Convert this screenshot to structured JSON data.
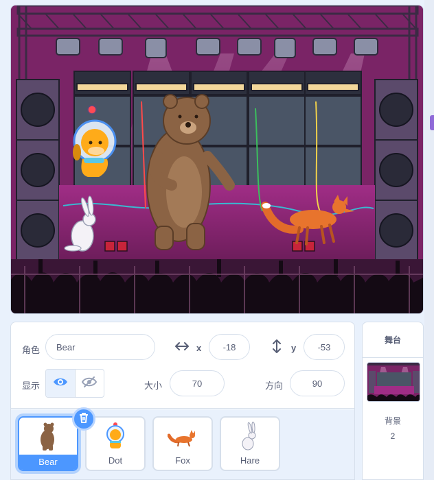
{
  "sprite_info": {
    "sprite_label": "角色",
    "sprite_name": "Bear",
    "x_label": "x",
    "x_value": "-18",
    "y_label": "y",
    "y_value": "-53",
    "show_label": "显示",
    "size_label": "大小",
    "size_value": "70",
    "direction_label": "方向",
    "direction_value": "90"
  },
  "sprites": [
    {
      "name": "Bear",
      "selected": true
    },
    {
      "name": "Dot",
      "selected": false
    },
    {
      "name": "Fox",
      "selected": false
    },
    {
      "name": "Hare",
      "selected": false
    }
  ],
  "stage_panel": {
    "title": "舞台",
    "backdrops_label": "背景",
    "backdrops_count": "2"
  },
  "colors": {
    "accent": "#4c97ff",
    "stage_purple": "#8a2a73",
    "panel_bg": "#e9f1fc"
  }
}
